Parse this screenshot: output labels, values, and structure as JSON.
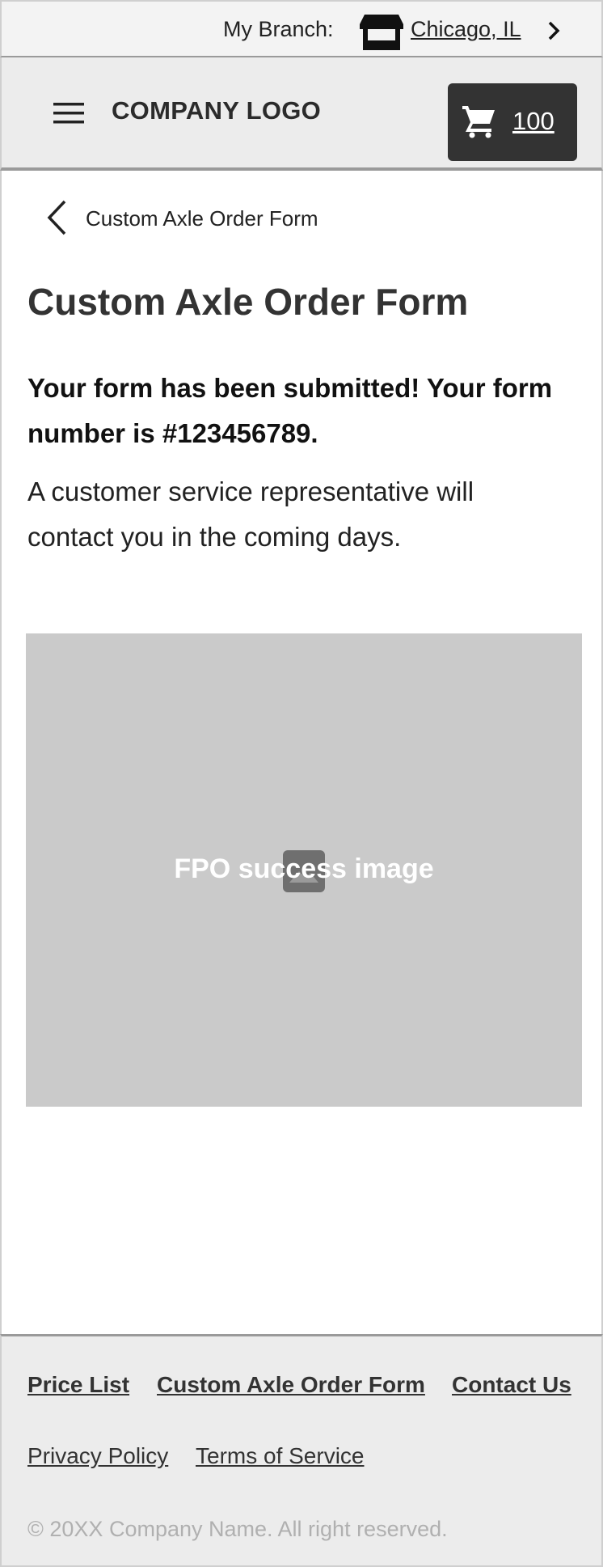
{
  "branch": {
    "label": "My Branch:",
    "icon": "store-icon",
    "city": "Chicago, IL",
    "chevron_icon": "chevron-right-icon"
  },
  "header": {
    "menu_icon": "hamburger-menu-icon",
    "logo": "COMPANY LOGO",
    "cart": {
      "icon": "shopping-cart-icon",
      "count": "100"
    }
  },
  "breadcrumb": {
    "back_icon": "chevron-left-icon",
    "label": "Custom Axle Order Form"
  },
  "main": {
    "title": "Custom Axle Order Form",
    "confirmation": "Your form has been submitted! Your form number is #123456789.",
    "subtext": "A customer service representative will contact you in the coming days.",
    "image": {
      "icon": "image-icon",
      "label": "FPO success image"
    }
  },
  "footer": {
    "links_row1": [
      "Price List",
      "Custom Axle Order Form",
      "Contact Us"
    ],
    "links_row2": [
      "Privacy Policy",
      "Terms of Service"
    ],
    "copyright": "© 20XX Company Name. All right reserved."
  },
  "colors": {
    "header_bg": "#ececec",
    "cart_bg": "#333333",
    "placeholder_bg": "#cacaca",
    "text": "#333333"
  }
}
